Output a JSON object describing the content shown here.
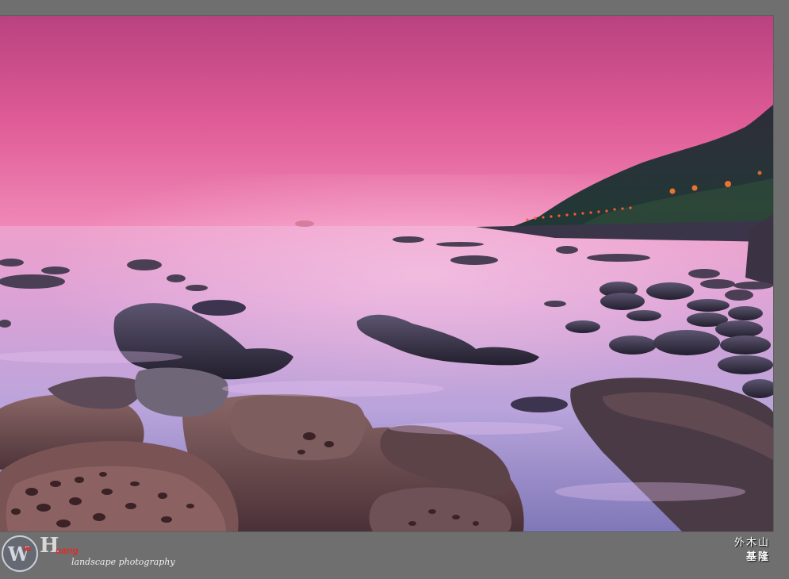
{
  "photo": {
    "description_icon": "seascape-photo",
    "colors": {
      "sky_top": "#b8427f",
      "sky_mid": "#e05c97",
      "horizon": "#f39ac2",
      "water_near": "#9b86c8",
      "water_far": "#e9a2cf",
      "rock_dark": "#2a2536",
      "rock_warm": "#6b4a48",
      "hill": "#2b2f3b",
      "lights": "#ff5a2a"
    }
  },
  "watermark": {
    "circle_letter": "W",
    "in_text": "in",
    "h_letter": "H",
    "uang_text": "uang",
    "tagline": "landscape photography"
  },
  "caption": {
    "line1": "外木山",
    "line2": "基隆"
  }
}
